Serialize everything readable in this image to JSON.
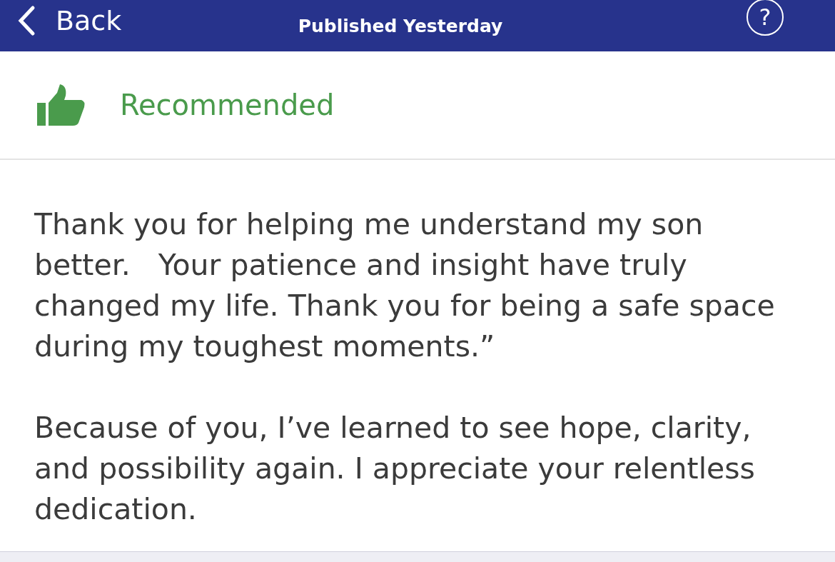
{
  "header": {
    "back_label": "Back",
    "title": "Published Yesterday",
    "help_label": "?"
  },
  "recommendation": {
    "label": "Recommended"
  },
  "review": {
    "paragraphs": [
      "Thank you for helping me understand my son better.   Your patience and insight have truly changed my life. Thank you for being a safe space during my toughest moments.”",
      "Because of you, I’ve learned to see hope, clarity, and possibility again. I appreciate your relentless dedication."
    ]
  }
}
